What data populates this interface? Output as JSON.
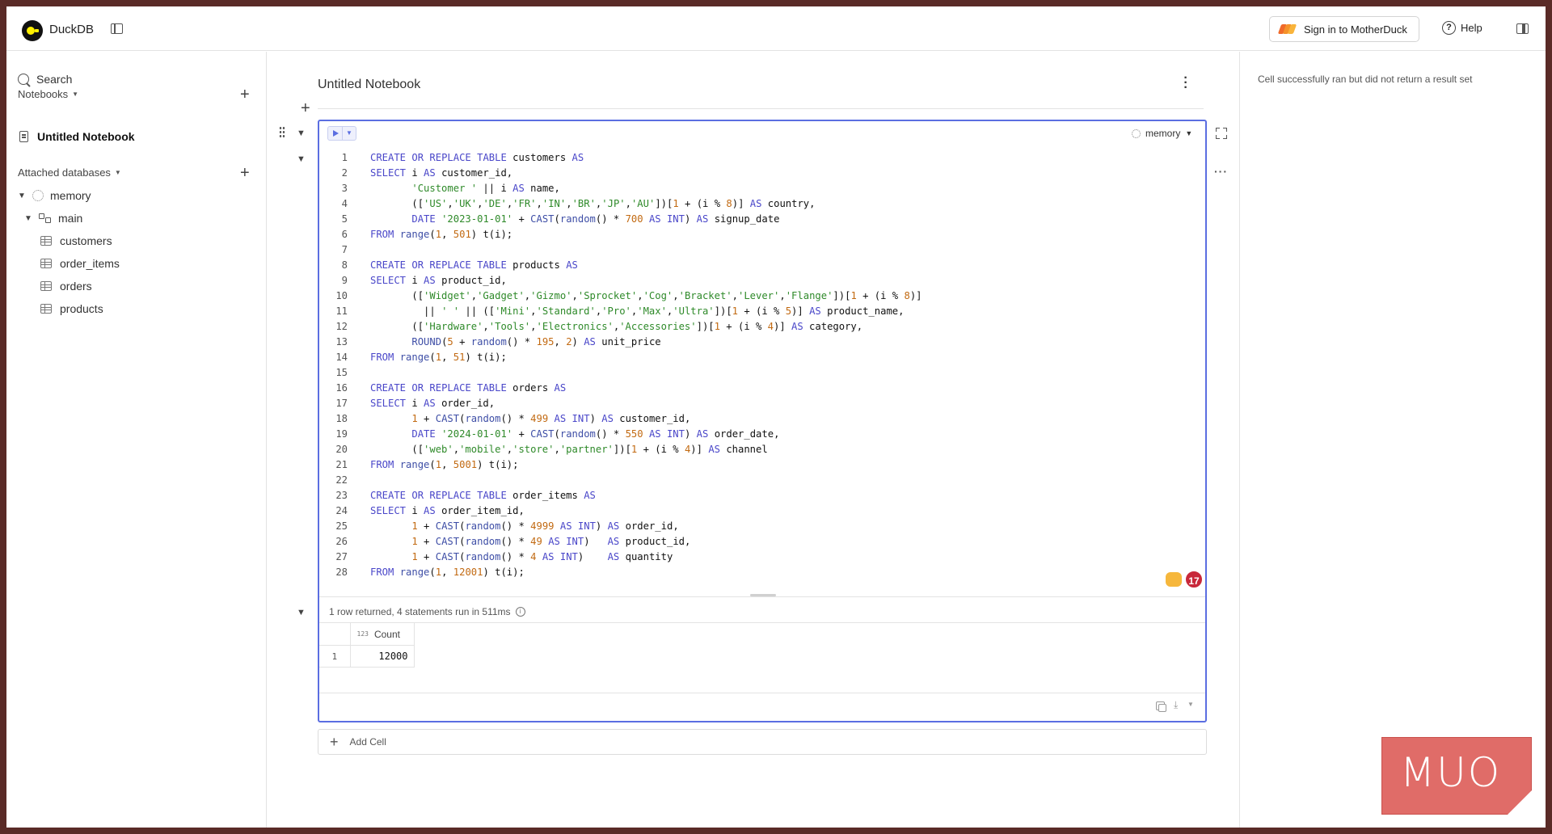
{
  "app": {
    "name": "DuckDB"
  },
  "header": {
    "signin_label": "Sign in to MotherDuck",
    "help_label": "Help"
  },
  "sidebar": {
    "search_label": "Search",
    "notebooks_label": "Notebooks",
    "notebook_item": "Untitled Notebook",
    "attached_label": "Attached databases",
    "tree": {
      "database": "memory",
      "schema": "main",
      "tables": [
        "customers",
        "order_items",
        "orders",
        "products"
      ]
    }
  },
  "notebook": {
    "title": "Untitled Notebook",
    "cell": {
      "database_select": "memory",
      "code_lines": [
        "CREATE OR REPLACE TABLE customers AS",
        "SELECT i AS customer_id,",
        "       'Customer ' || i AS name,",
        "       (['US','UK','DE','FR','IN','BR','JP','AU'])[1 + (i % 8)] AS country,",
        "       DATE '2023-01-01' + CAST(random() * 700 AS INT) AS signup_date",
        "FROM range(1, 501) t(i);",
        "",
        "CREATE OR REPLACE TABLE products AS",
        "SELECT i AS product_id,",
        "       (['Widget','Gadget','Gizmo','Sprocket','Cog','Bracket','Lever','Flange'])[1 + (i % 8)]",
        "         || ' ' || (['Mini','Standard','Pro','Max','Ultra'])[1 + (i % 5)] AS product_name,",
        "       (['Hardware','Tools','Electronics','Accessories'])[1 + (i % 4)] AS category,",
        "       ROUND(5 + random() * 195, 2) AS unit_price",
        "FROM range(1, 51) t(i);",
        "",
        "CREATE OR REPLACE TABLE orders AS",
        "SELECT i AS order_id,",
        "       1 + CAST(random() * 499 AS INT) AS customer_id,",
        "       DATE '2024-01-01' + CAST(random() * 550 AS INT) AS order_date,",
        "       (['web','mobile','store','partner'])[1 + (i % 4)] AS channel",
        "FROM range(1, 5001) t(i);",
        "",
        "CREATE OR REPLACE TABLE order_items AS",
        "SELECT i AS order_item_id,",
        "       1 + CAST(random() * 4999 AS INT) AS order_id,",
        "       1 + CAST(random() * 49 AS INT)   AS product_id,",
        "       1 + CAST(random() * 4 AS INT)    AS quantity",
        "FROM range(1, 12001) t(i);"
      ],
      "collaborator_count": "17",
      "result_status": "1 row returned, 4 statements run in 511ms",
      "result": {
        "column_type": "123",
        "column_header": "Count",
        "rows": [
          {
            "row_number": "1",
            "value": "12000"
          }
        ]
      }
    },
    "add_cell_label": "Add Cell"
  },
  "right_panel": {
    "message": "Cell successfully ran but did not return a result set"
  },
  "watermark": {
    "text": "MUO"
  },
  "colors": {
    "accent": "#5b6ee1",
    "keyword": "#4a47c9",
    "string": "#2f8a2a",
    "number": "#c26a12",
    "badge": "#c8283a"
  }
}
